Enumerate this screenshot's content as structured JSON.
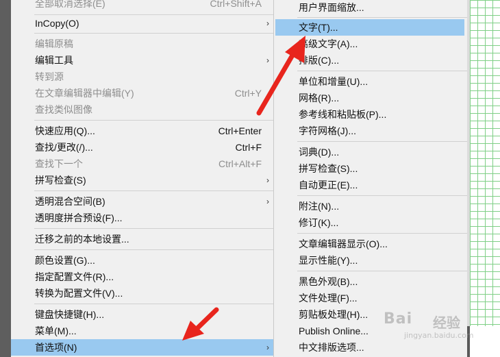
{
  "left_menu": {
    "items": [
      {
        "label": "全部取消选择(E)",
        "shortcut": "Ctrl+Shift+A",
        "disabled": true
      },
      {
        "label": "InCopy(O)",
        "submenu": true
      },
      {
        "label": "编辑原稿",
        "disabled": true
      },
      {
        "label": "编辑工具",
        "submenu": true
      },
      {
        "label": "转到源",
        "disabled": true
      },
      {
        "label": "在文章编辑器中编辑(Y)",
        "shortcut": "Ctrl+Y",
        "disabled": true
      },
      {
        "label": "查找类似图像",
        "disabled": true
      },
      {
        "label": "快速应用(Q)...",
        "shortcut": "Ctrl+Enter"
      },
      {
        "label": "查找/更改(/)...",
        "shortcut": "Ctrl+F"
      },
      {
        "label": "查找下一个",
        "shortcut": "Ctrl+Alt+F",
        "disabled": true
      },
      {
        "label": "拼写检查(S)",
        "submenu": true
      },
      {
        "label": "透明混合空间(B)",
        "submenu": true
      },
      {
        "label": "透明度拼合预设(F)..."
      },
      {
        "label": "迁移之前的本地设置..."
      },
      {
        "label": "颜色设置(G)..."
      },
      {
        "label": "指定配置文件(R)..."
      },
      {
        "label": "转换为配置文件(V)..."
      },
      {
        "label": "键盘快捷键(H)..."
      },
      {
        "label": "菜单(M)..."
      },
      {
        "label": "首选项(N)",
        "submenu": true,
        "highlighted": true
      }
    ],
    "submenu_arrow": "›"
  },
  "right_menu": {
    "items": [
      {
        "label": "用户界面缩放..."
      },
      {
        "label": "文字(T)...",
        "highlighted": true
      },
      {
        "label": "高级文字(A)..."
      },
      {
        "label": "排版(C)..."
      },
      {
        "label": "单位和增量(U)..."
      },
      {
        "label": "网格(R)..."
      },
      {
        "label": "参考线和粘贴板(P)..."
      },
      {
        "label": "字符网格(J)..."
      },
      {
        "label": "词典(D)..."
      },
      {
        "label": "拼写检查(S)..."
      },
      {
        "label": "自动更正(E)..."
      },
      {
        "label": "附注(N)..."
      },
      {
        "label": "修订(K)..."
      },
      {
        "label": "文章编辑器显示(O)..."
      },
      {
        "label": "显示性能(Y)..."
      },
      {
        "label": "黑色外观(B)..."
      },
      {
        "label": "文件处理(F)..."
      },
      {
        "label": "剪贴板处理(H)..."
      },
      {
        "label": "Publish Online..."
      },
      {
        "label": "中文排版选项..."
      }
    ]
  },
  "watermark": {
    "brand": "Bai",
    "brand_suffix": "经验",
    "url": "jingyan.baidu.com"
  },
  "colors": {
    "menu_bg": "#f0f0f0",
    "highlight": "#99c9f0",
    "arrow": "#e8251d",
    "grid_line": "#7fcf86"
  }
}
